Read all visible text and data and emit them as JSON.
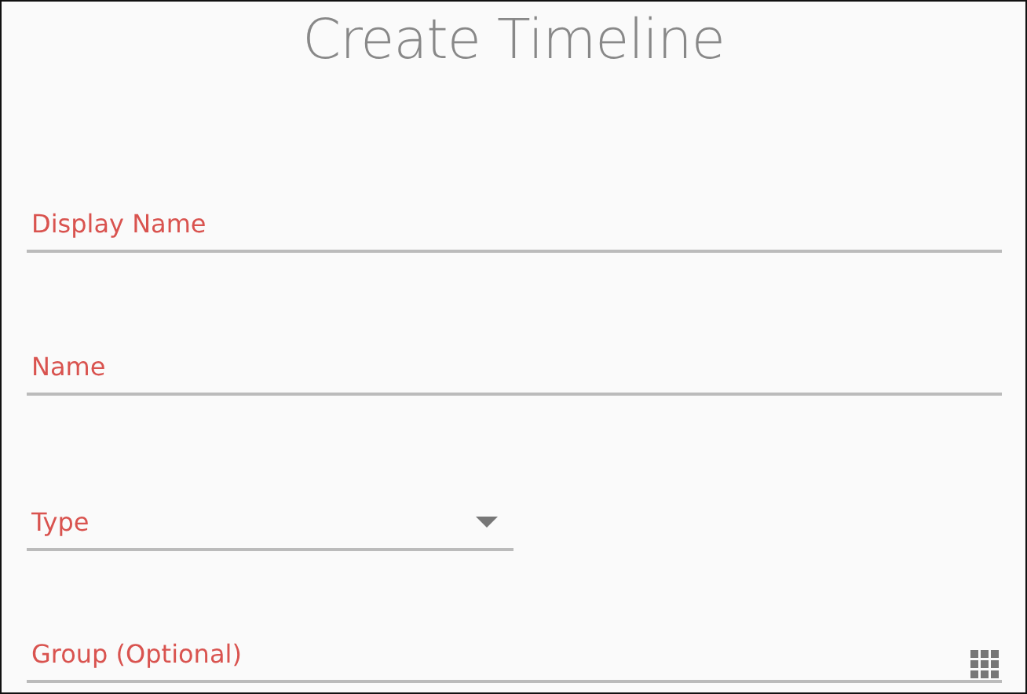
{
  "title": "Create Timeline",
  "fields": [
    {
      "kind": "text",
      "placeholder": "Display Name",
      "invalid": true
    },
    {
      "kind": "text",
      "placeholder": "Name",
      "invalid": true
    },
    {
      "kind": "select",
      "placeholder": "Type",
      "invalid": true
    },
    {
      "kind": "picker",
      "placeholder": "Group (Optional)",
      "invalid": true
    }
  ]
}
